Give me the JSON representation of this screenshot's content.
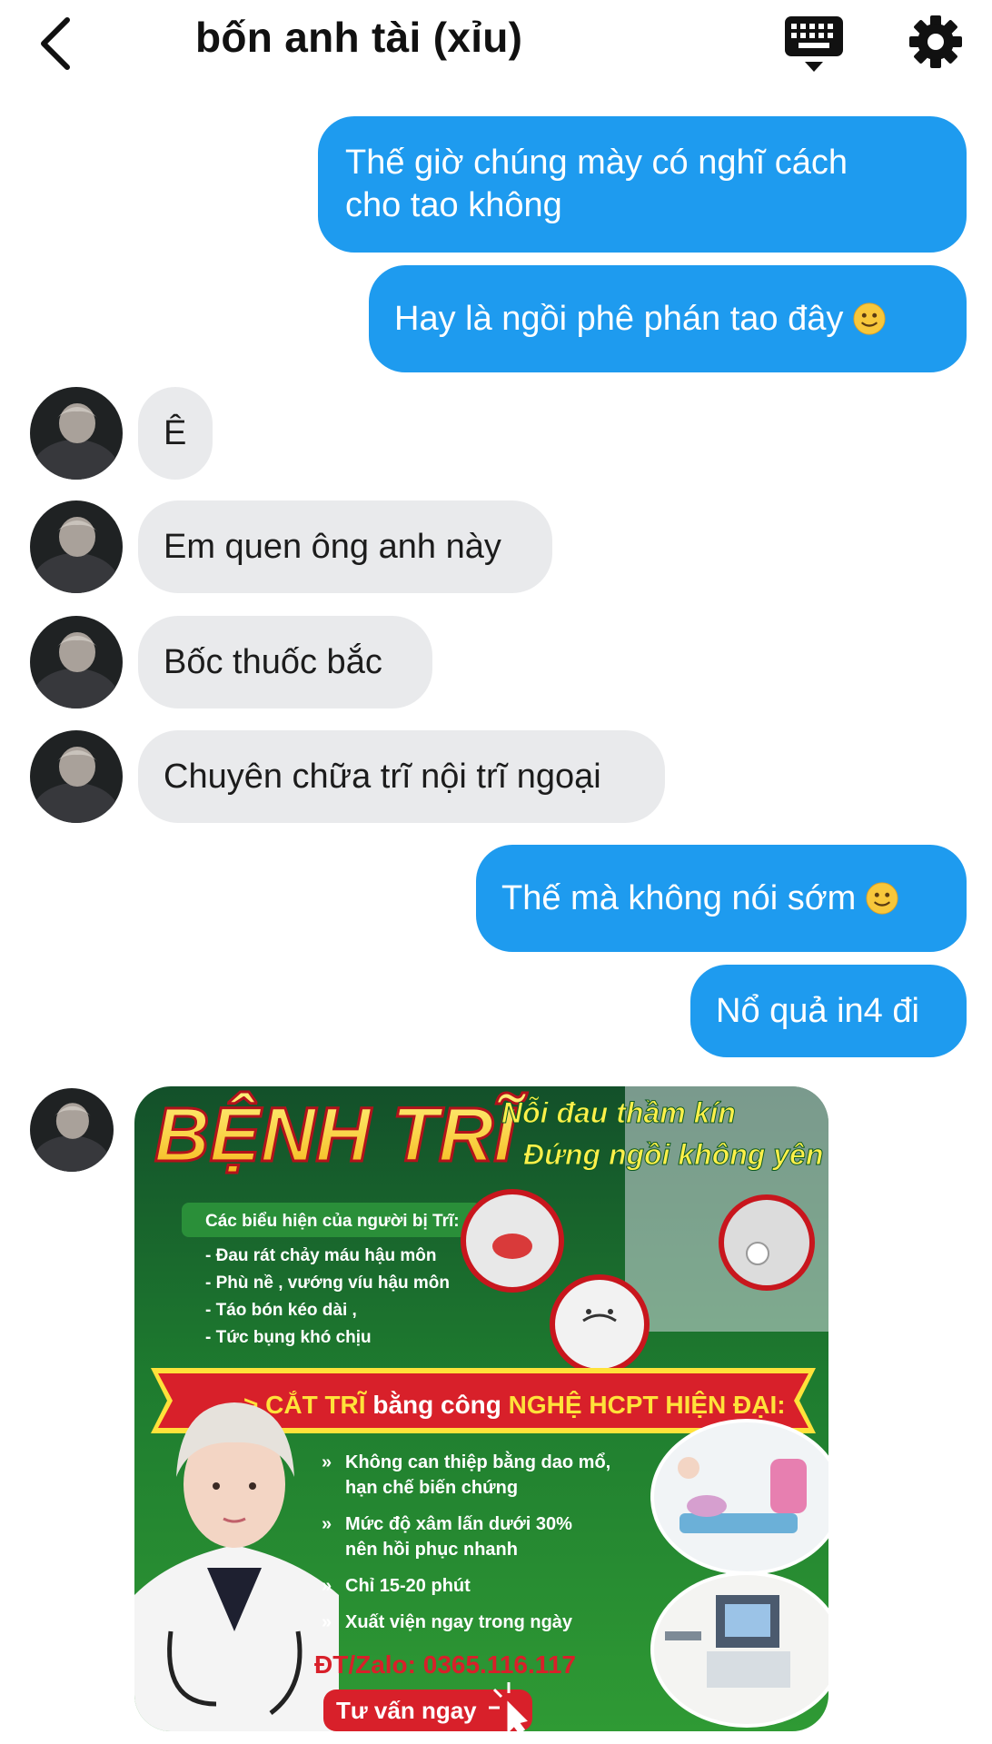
{
  "header": {
    "title": "bốn anh tài (xỉu)",
    "back_icon": "chevron-left-icon",
    "keyboard_icon": "keyboard-icon",
    "settings_icon": "gear-icon"
  },
  "messages": [
    {
      "side": "out",
      "text_line1": "Thế giờ chúng mày có nghĩ cách",
      "text_line2": "cho tao không"
    },
    {
      "side": "out",
      "text": "Hay là ngồi phê phán tao đây",
      "emoji": "slight-smile"
    },
    {
      "side": "in",
      "text": "Ê"
    },
    {
      "side": "in",
      "text": "Em quen ông anh này"
    },
    {
      "side": "in",
      "text": "Bốc thuốc bắc"
    },
    {
      "side": "in",
      "text": "Chuyên chữa trĩ nội trĩ ngoại"
    },
    {
      "side": "out",
      "text": "Thế mà không nói sớm",
      "emoji": "slight-smile"
    },
    {
      "side": "out",
      "text": "Nổ quả in4 đi"
    }
  ],
  "poster": {
    "title": "BỆNH TRĨ",
    "tagline1": "Nỗi đau thầm kín",
    "tagline2": "Đứng ngồi không yên",
    "symptoms_title": "Các biểu hiện của người bị Trĩ:",
    "symptoms": [
      "- Đau rát chảy máu hậu môn",
      "- Phù nề , vướng víu hậu môn",
      "- Táo bón kéo dài ,",
      "- Tức bụng khó chịu"
    ],
    "banner_part1": "> CẮT TRĨ",
    "banner_part2": " bằng công ",
    "banner_part3": "NGHỆ HCPT HIỆN ĐẠI:",
    "benefits": [
      {
        "line1": "Không can thiệp bằng dao mổ,",
        "line2": "hạn chế biến chứng"
      },
      {
        "line1": "Mức độ xâm lấn dưới 30%",
        "line2": "nên hồi phục nhanh"
      },
      {
        "line1": "Chỉ 15-20 phút",
        "line2": ""
      },
      {
        "line1": "Xuất viện ngay trong ngày",
        "line2": ""
      }
    ],
    "contact": "ĐT/Zalo: 0365.116.117",
    "cta": "Tư vấn ngay"
  },
  "colors": {
    "outgoing": "#1e9bef",
    "incoming": "#e9eaec",
    "poster_green": "#1f7a2c",
    "poster_red": "#d8202a",
    "poster_yellow": "#ffe23a"
  }
}
